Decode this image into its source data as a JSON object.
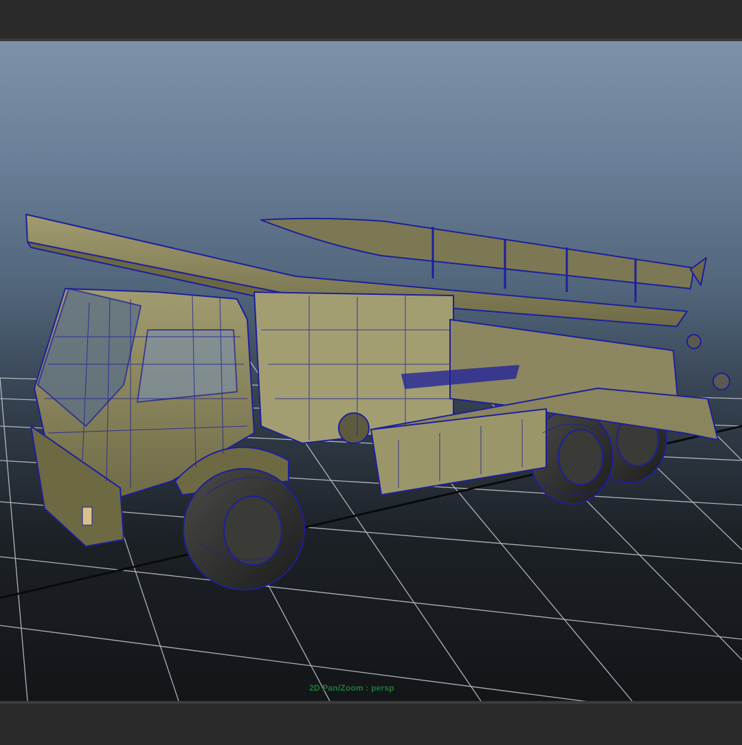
{
  "viewport": {
    "camera": "persp",
    "hud_label": "2D Pan/Zoom : persp"
  },
  "colors": {
    "wireframe": "#1d1f9c",
    "body": "#8f8a5f",
    "grid": "#c8ccd2",
    "hud_text": "#1f7a3a"
  }
}
